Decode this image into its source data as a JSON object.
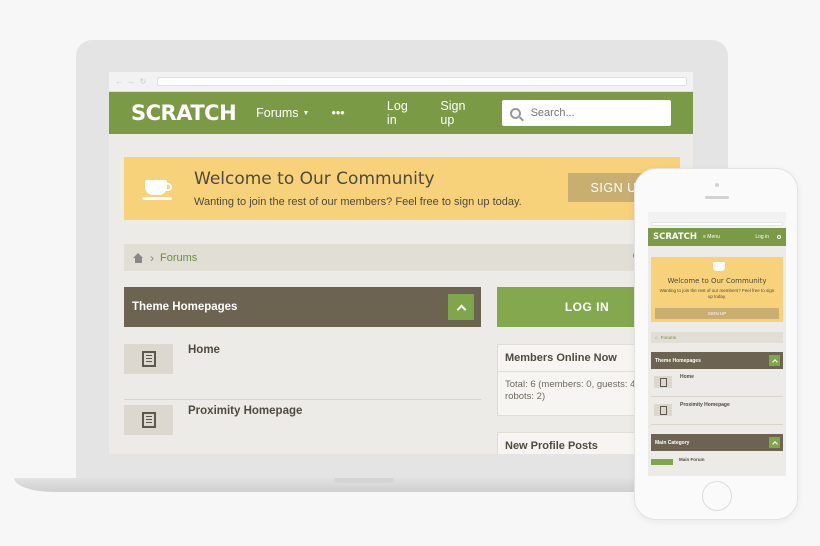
{
  "site": {
    "logo": "SCRATCH"
  },
  "nav": {
    "forums": "Forums",
    "more": "•••",
    "login": "Log in",
    "signup": "Sign up"
  },
  "search": {
    "placeholder": "Search..."
  },
  "welcome": {
    "title": "Welcome to Our Community",
    "subtitle": "Wanting to join the rest of our members? Feel free to sign up today.",
    "button": "SIGN UP"
  },
  "breadcrumb": {
    "forums": "Forums"
  },
  "nodes": {
    "category_title": "Theme Homepages",
    "items": [
      {
        "title": "Home"
      },
      {
        "title": "Proximity Homepage"
      }
    ]
  },
  "sidebar": {
    "login_button": "LOG IN",
    "members_online_title": "Members Online Now",
    "members_online_text": "Total: 6 (members: 0, guests: 4, robots: 2)",
    "profile_posts_title": "New Profile Posts"
  },
  "phone": {
    "logo": "SCRATCH",
    "menu": "≡ Menu",
    "login": "Log in",
    "welcome_title": "Welcome to Our Community",
    "welcome_subtitle": "Wanting to join the rest of our members? Feel free to sign up today.",
    "signup": "SIGN UP",
    "crumb": "Forums",
    "category_title": "Theme Homepages",
    "items": [
      {
        "title": "Home"
      },
      {
        "title": "Proximity Homepage"
      }
    ],
    "main_category": "Main Category",
    "main_forum": "Main Forum"
  },
  "colors": {
    "header_green": "#7a9a45",
    "notice_yellow": "#f7d27a",
    "node_brown": "#6c6350",
    "button_green": "#84a84e"
  }
}
